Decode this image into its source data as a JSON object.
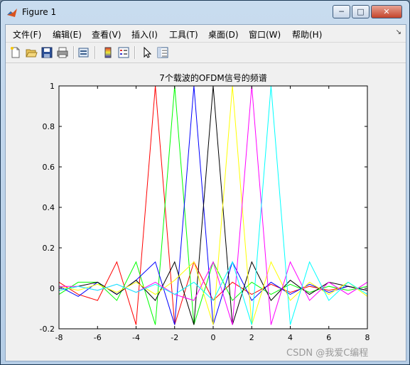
{
  "window": {
    "title": "Figure 1"
  },
  "menu": [
    "文件(F)",
    "编辑(E)",
    "查看(V)",
    "插入(I)",
    "工具(T)",
    "桌面(D)",
    "窗口(W)",
    "帮助(H)"
  ],
  "icons": [
    "new-figure-icon",
    "open-folder-icon",
    "save-icon",
    "print-icon",
    "print-preview-icon",
    "colorbar-icon",
    "legend-icon",
    "pointer-icon",
    "property-editor-icon"
  ],
  "watermark": "CSDN @我爱C编程",
  "chart_data": {
    "type": "line",
    "title": "7个载波的OFDM信号的频谱",
    "xlabel": "",
    "ylabel": "",
    "xlim": [
      -8,
      8
    ],
    "ylim": [
      -0.2,
      1
    ],
    "xticks": [
      -8,
      -6,
      -4,
      -2,
      0,
      2,
      4,
      6,
      8
    ],
    "yticks": [
      -0.2,
      0,
      0.2,
      0.4,
      0.6,
      0.8,
      1
    ],
    "x": [
      -8,
      -7,
      -6,
      -5,
      -4,
      -3,
      -2,
      -1,
      0,
      1,
      2,
      3,
      4,
      5,
      6,
      7,
      8
    ],
    "grid": false,
    "series": [
      {
        "color": "#ff0000",
        "center": -3,
        "values": [
          0.03,
          -0.03,
          -0.06,
          0.13,
          -0.18,
          1,
          -0.18,
          0.13,
          -0.06,
          0.03,
          -0.03,
          0.02,
          -0.02,
          0.01,
          -0.01,
          0.01,
          -0.01
        ]
      },
      {
        "color": "#00ff00",
        "center": -2,
        "values": [
          -0.03,
          0.03,
          0.03,
          -0.06,
          0.13,
          -0.18,
          1,
          -0.18,
          0.13,
          -0.06,
          0.03,
          -0.03,
          0.02,
          -0.02,
          0.01,
          -0.01,
          0.01
        ]
      },
      {
        "color": "#0000ff",
        "center": -1,
        "values": [
          0.01,
          -0.04,
          0.03,
          -0.03,
          0.04,
          0.13,
          -0.18,
          1,
          -0.18,
          0.13,
          -0.06,
          0.03,
          -0.03,
          0.02,
          -0.02,
          0.01,
          -0.01
        ]
      },
      {
        "color": "#000000",
        "center": 0,
        "values": [
          -0.01,
          0.01,
          0.03,
          -0.03,
          0.04,
          -0.06,
          0.13,
          -0.18,
          1,
          -0.18,
          0.13,
          -0.06,
          0.04,
          -0.03,
          0.03,
          0.01,
          -0.01
        ]
      },
      {
        "color": "#ffff00",
        "center": 1,
        "values": [
          0.01,
          -0.01,
          0.02,
          -0.02,
          0.03,
          -0.03,
          0.04,
          0.13,
          -0.18,
          1,
          -0.18,
          0.13,
          -0.06,
          0.03,
          -0.03,
          0.03,
          -0.04
        ]
      },
      {
        "color": "#ff00ff",
        "center": 2,
        "values": [
          0.01,
          0.01,
          -0.01,
          0.02,
          -0.02,
          0.03,
          -0.03,
          -0.06,
          0.13,
          -0.18,
          1,
          -0.18,
          0.13,
          -0.06,
          0.03,
          -0.03,
          0.03
        ]
      },
      {
        "color": "#00ffff",
        "center": 3,
        "values": [
          -0.01,
          0.01,
          -0.01,
          0.02,
          -0.02,
          0.02,
          -0.03,
          0.03,
          -0.06,
          0.13,
          -0.18,
          1,
          -0.18,
          0.13,
          -0.06,
          0.03,
          -0.03
        ]
      }
    ]
  }
}
